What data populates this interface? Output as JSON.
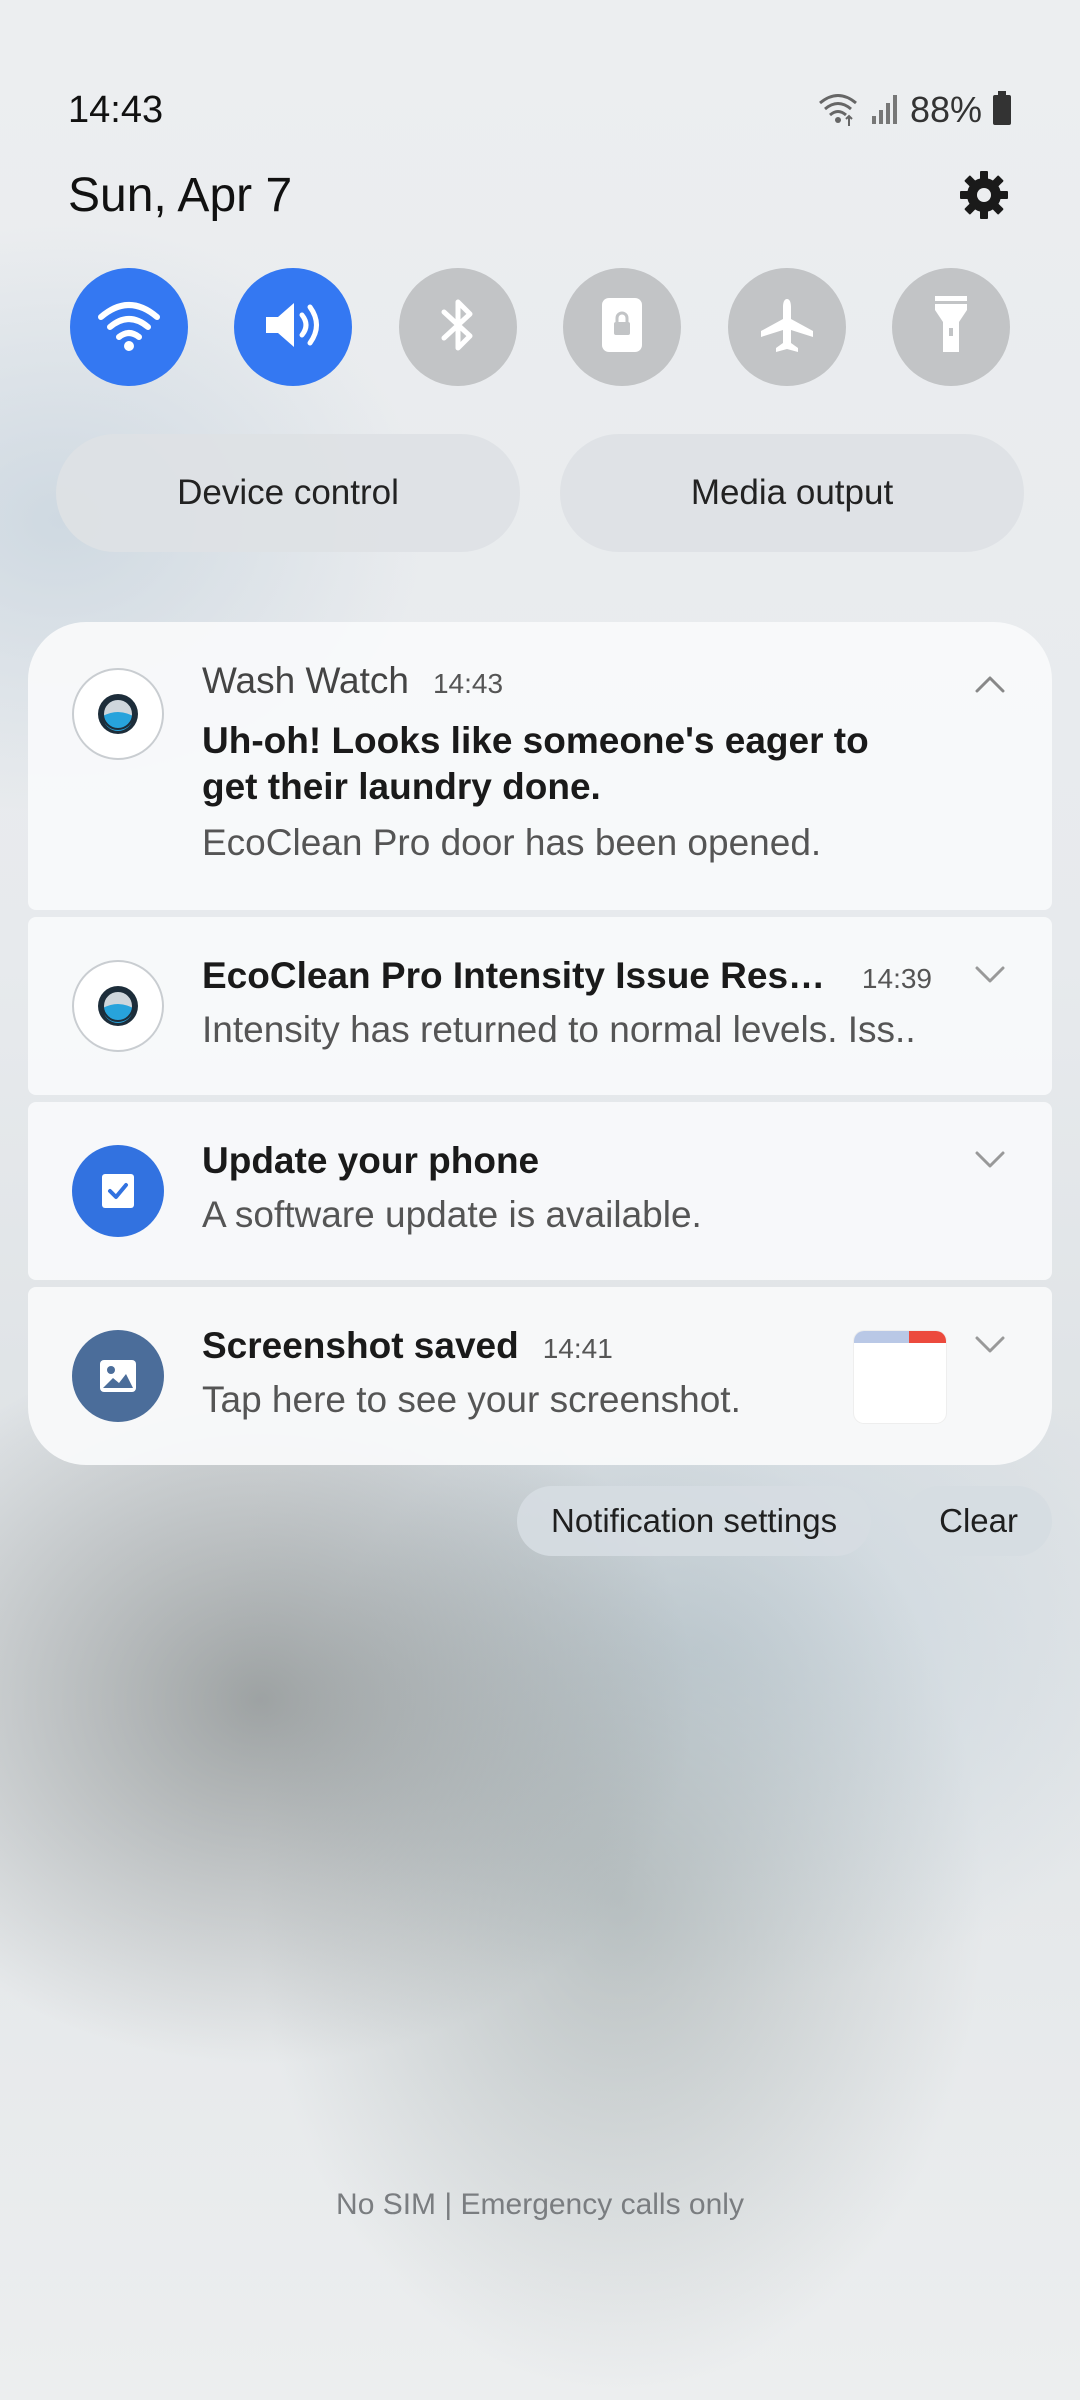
{
  "status_bar": {
    "time": "14:43",
    "battery": "88%"
  },
  "header": {
    "date": "Sun, Apr 7"
  },
  "quick_toggles": [
    {
      "name": "Wi-Fi",
      "icon": "wifi-icon",
      "state": "on"
    },
    {
      "name": "Sound",
      "icon": "sound-icon",
      "state": "on"
    },
    {
      "name": "Bluetooth",
      "icon": "bluetooth-icon",
      "state": "off"
    },
    {
      "name": "Portrait lock",
      "icon": "rotation-lock-icon",
      "state": "off"
    },
    {
      "name": "Airplane mode",
      "icon": "airplane-icon",
      "state": "off"
    },
    {
      "name": "Flashlight",
      "icon": "flashlight-icon",
      "state": "off"
    }
  ],
  "pills": {
    "device_control": "Device control",
    "media_output": "Media output"
  },
  "notifications": [
    {
      "app": "Wash Watch",
      "time": "14:43",
      "headline": "Uh-oh! Looks like someone's eager to get their laundry done.",
      "body": "EcoClean Pro door has been opened.",
      "expanded": true
    },
    {
      "title": "EcoClean Pro Intensity Issue Resol…",
      "time": "14:39",
      "body": "Intensity has returned to normal levels. Iss.."
    },
    {
      "title": "Update your phone",
      "body": "A software update is available."
    },
    {
      "title": "Screenshot saved",
      "time": "14:41",
      "body": "Tap here to see your screenshot."
    }
  ],
  "actions": {
    "settings": "Notification settings",
    "clear": "Clear"
  },
  "footer": {
    "carrier": "No SIM | Emergency calls only"
  },
  "colors": {
    "accent": "#3478f2",
    "toggle_off": "#c2c4c6",
    "screenshot_icon": "#4b6d9a"
  }
}
